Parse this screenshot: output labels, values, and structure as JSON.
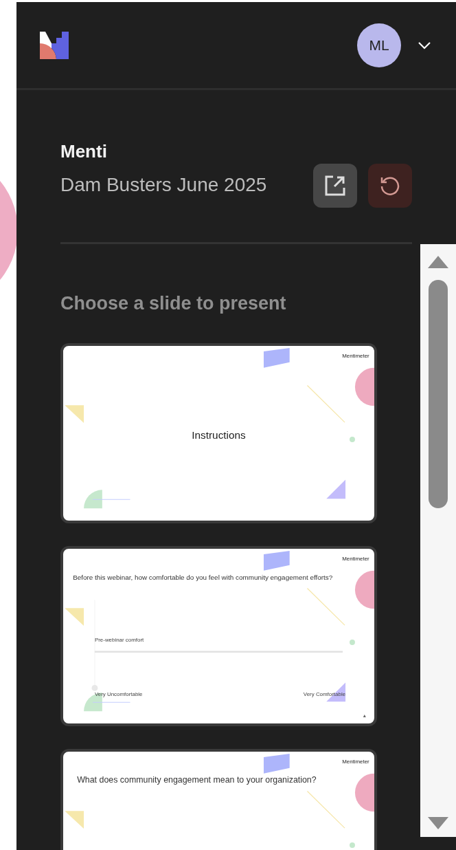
{
  "header": {
    "avatar_initials": "ML"
  },
  "presentation": {
    "label": "Menti",
    "title": "Dam Busters June 2025"
  },
  "section_title": "Choose a slide to present",
  "slides": [
    {
      "kind": "title",
      "logo": "Mentimeter",
      "title": "Instructions"
    },
    {
      "kind": "scale",
      "logo": "Mentimeter",
      "question": "Before this webinar, how comfortable do you feel with community engagement efforts?",
      "statement": "Pre-webinar comfort",
      "min_label": "Very Uncomfortable",
      "max_label": "Very Comfortable"
    },
    {
      "kind": "question",
      "logo": "Mentimeter",
      "question": "What does community engagement mean to your organization?"
    }
  ]
}
